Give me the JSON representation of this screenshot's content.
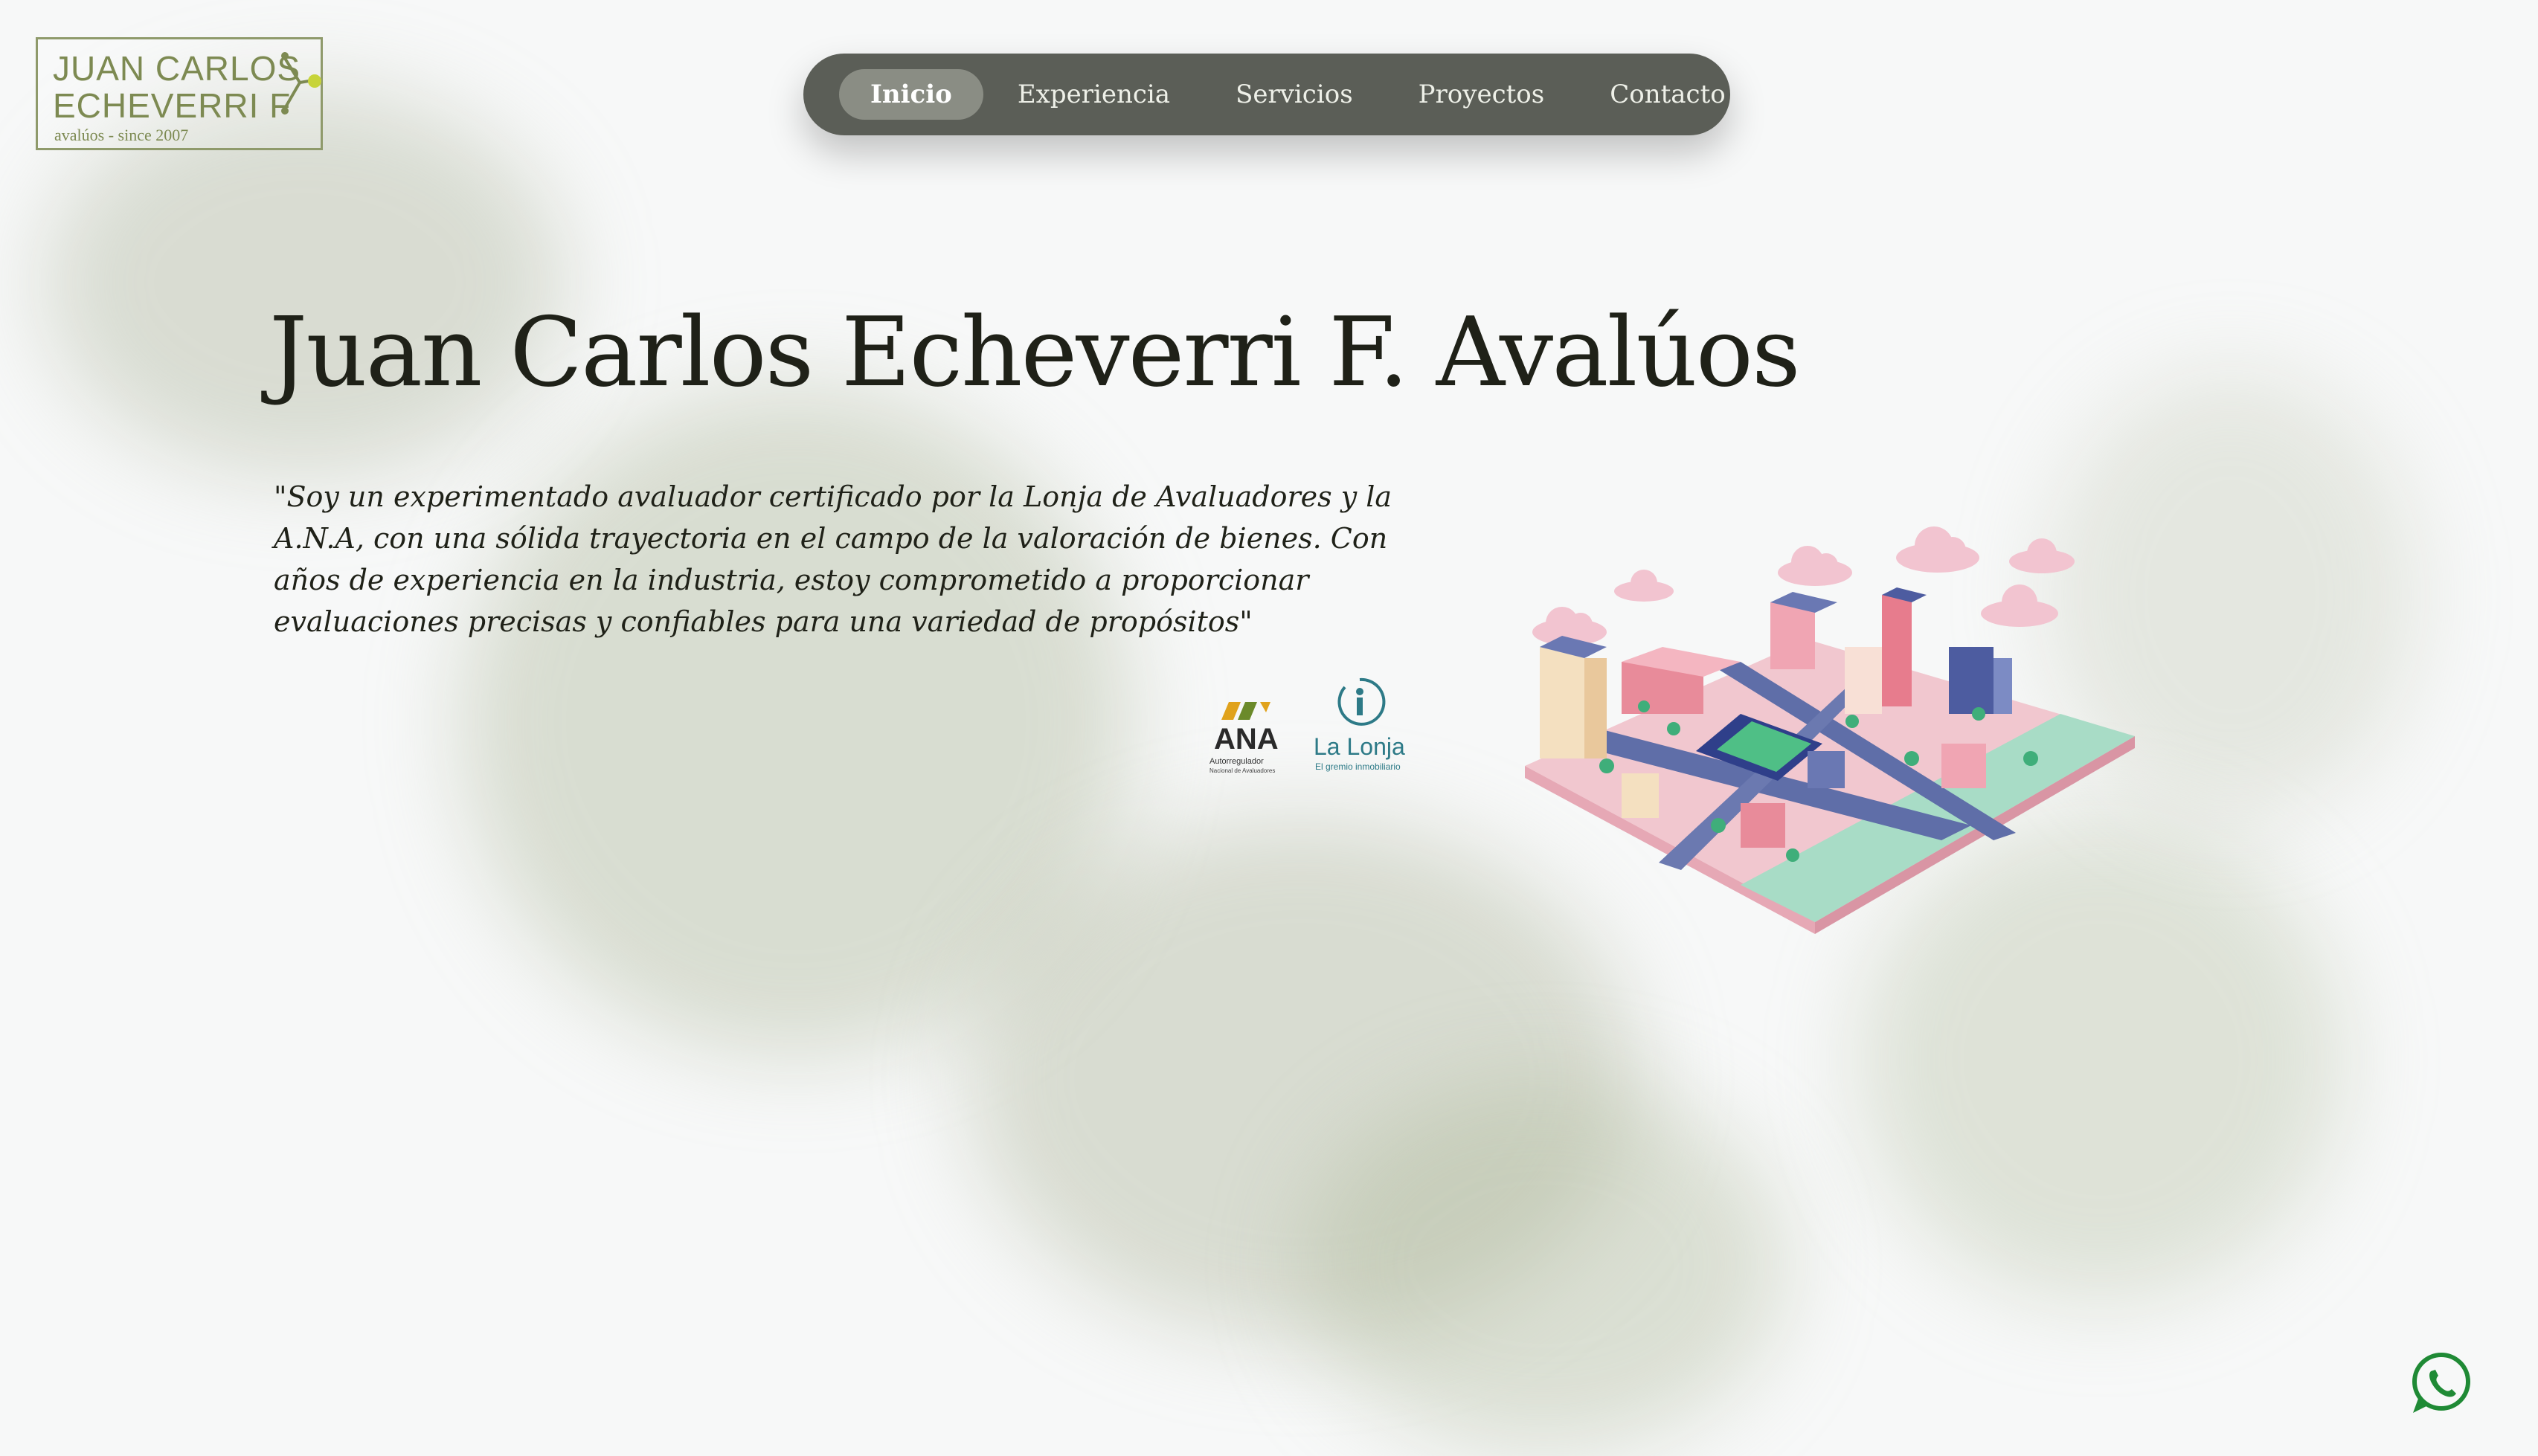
{
  "logo": {
    "line1": "JUAN CARLOS",
    "line2": "ECHEVERRI F",
    "tagline": "avalúos - since 2007"
  },
  "nav": {
    "items": [
      "Inicio",
      "Experiencia",
      "Servicios",
      "Proyectos",
      "Contacto"
    ],
    "active": "Inicio"
  },
  "hero": {
    "title": "Juan Carlos Echeverri F. Avalúos",
    "quote": "\"Soy un experimentado avaluador certificado por la Lonja de Avaluadores y la A.N.A, con una sólida trayectoria en el campo de la valoración de bienes. Con años de experiencia en la industria, estoy comprometido a proporcionar evaluaciones precisas y confiables para una variedad de propósitos\""
  },
  "certifications": {
    "ana": {
      "name": "ANA",
      "subtitle": "Autorregulador",
      "subtitle2": "Nacional de Avaluadores"
    },
    "lonja": {
      "name": "La Lonja",
      "subtitle": "El gremio inmobiliario"
    }
  },
  "icons": {
    "whatsapp": "whatsapp-icon",
    "illustration": "isometric-city-illustration"
  },
  "colors": {
    "nav_bg": "#5b5e57",
    "nav_active": "#8a8d84",
    "brand_olive": "#7d8a52",
    "text_dark": "#1f2118",
    "whatsapp_green": "#1f8a35"
  }
}
